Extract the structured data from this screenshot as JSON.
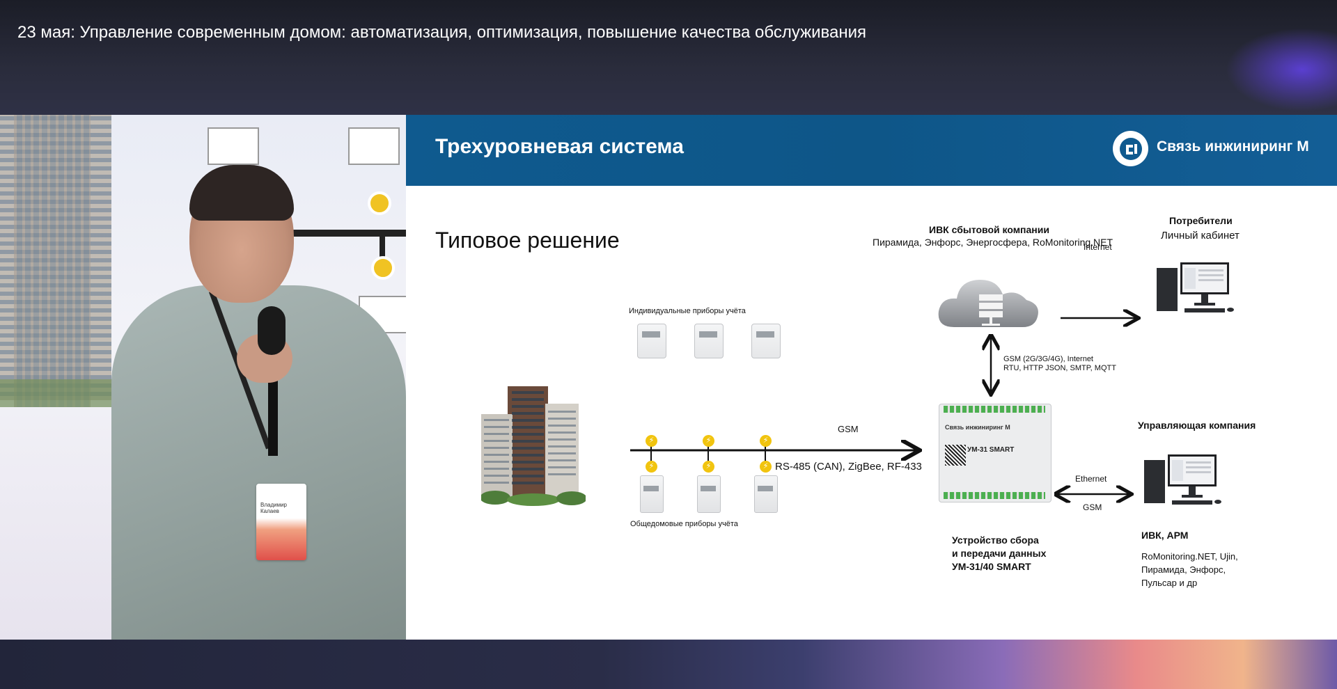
{
  "event": {
    "title": "23 мая: Управление современным домом: автоматизация, оптимизация, повышение качества обслуживания"
  },
  "speaker_video": {
    "badge_name": "Владимир Калаев"
  },
  "slide": {
    "title": "Трехуровневая система",
    "company": "Связь инжиниринг М",
    "subtitle": "Типовое решение",
    "ivk_title": "ИВК сбытовой компании",
    "ivk_systems": "Пирамида, Энфорс, Энергосфера, RoMonitoring.NET",
    "consumers_title": "Потребители",
    "consumers_sub": "Личный кабинет",
    "internet_label": "Internet",
    "gsm_protocols_1": "GSM (2G/3G/4G), Internet",
    "gsm_protocols_2": "RTU, HTTP JSON, SMTP, MQTT",
    "individual_meters": "Индивидуальные приборы учёта",
    "common_meters": "Общедомовые приборы учёта",
    "gsm_label": "GSM",
    "bus_label": "RS-485 (CAN), ZigBee, RF-433",
    "management_title": "Управляющая компания",
    "ethernet_label": "Ethernet",
    "gsm_label_2": "GSM",
    "device_line1": "Устройство сбора",
    "device_line2": "и передачи данных",
    "device_line3": "УМ-31/40 SMART",
    "device_brand": "Связь инжиниринг М",
    "device_model": "УМ-31 SMART",
    "ivk_arm_title": "ИВК, АРМ",
    "ivk_arm_list_1": "RoMonitoring.NET, Ujin,",
    "ivk_arm_list_2": "Пирамида, Энфорс,",
    "ivk_arm_list_3": "Пульсар и др"
  },
  "colors": {
    "slide_header": "#0f5a8f",
    "accent_yellow": "#f1c40f"
  }
}
